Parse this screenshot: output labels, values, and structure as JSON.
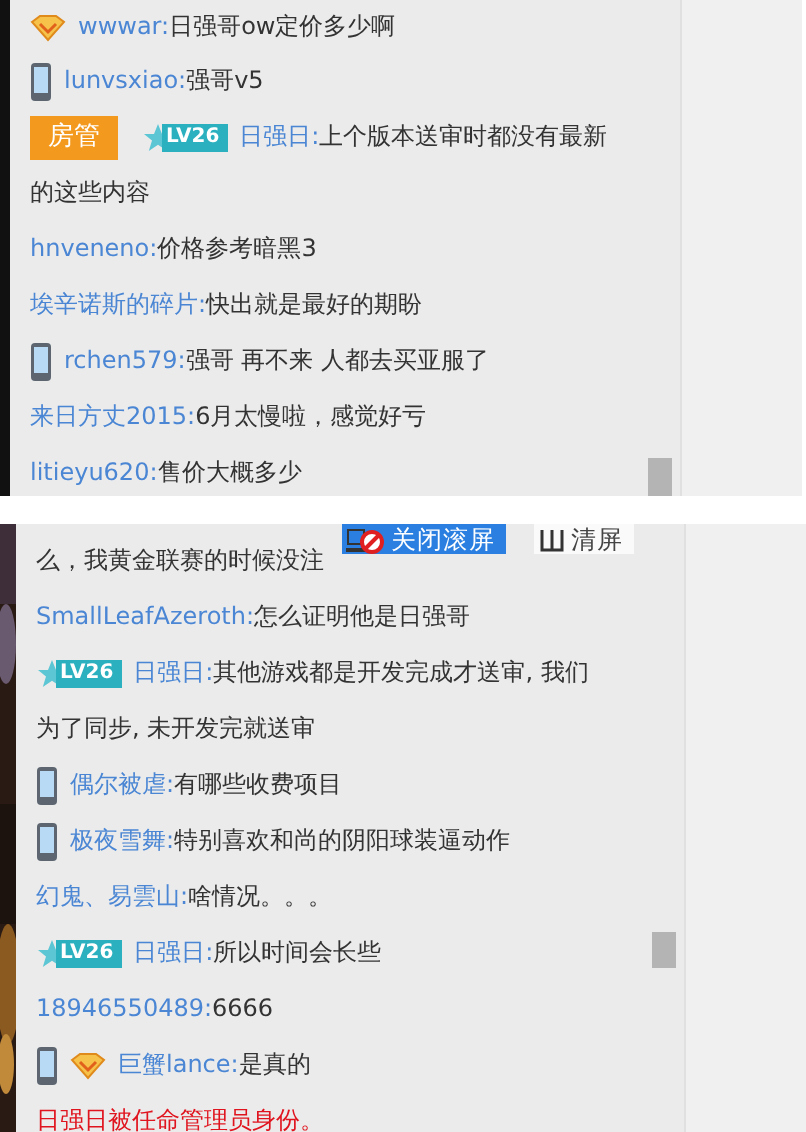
{
  "panels": [
    {
      "messages": [
        {
          "kind": "chat",
          "badges": [
            {
              "kind": "vip"
            }
          ],
          "user": "wwwar:",
          "text": "日强哥ow定价多少啊"
        },
        {
          "kind": "chat",
          "badges": [
            {
              "kind": "phone"
            }
          ],
          "user": "lunvsxiao:",
          "text": "强哥v5"
        },
        {
          "kind": "chat",
          "badges": [
            {
              "kind": "admin",
              "label": "房管"
            },
            {
              "kind": "level",
              "label": "LV26"
            }
          ],
          "user": "日强日:",
          "text": "上个版本送审时都没有最新",
          "text_continued": "的这些内容"
        },
        {
          "kind": "chat",
          "user": "hnveneno:",
          "text": "价格参考暗黑3"
        },
        {
          "kind": "chat",
          "user": "埃辛诺斯的碎片:",
          "text": "快出就是最好的期盼"
        },
        {
          "kind": "chat",
          "badges": [
            {
              "kind": "phone"
            }
          ],
          "user": "rchen579:",
          "text": "强哥 再不来 人都去买亚服了"
        },
        {
          "kind": "chat",
          "user": "来日方丈2015:",
          "text": "6月太慢啦，感觉好亏"
        },
        {
          "kind": "chat",
          "user": "litieyu620:",
          "text": "售价大概多少"
        }
      ]
    },
    {
      "toolbar": {
        "buttons": [
          {
            "kind": "scroll-lock",
            "label": "关闭滚屏",
            "selected": true
          },
          {
            "kind": "clear",
            "label": "清屏",
            "selected": false
          }
        ]
      },
      "messages": [
        {
          "kind": "fragment",
          "text": "么，我黄金联赛的时候没注"
        },
        {
          "kind": "chat",
          "user": "SmallLeafAzeroth:",
          "text": "怎么证明他是日强哥"
        },
        {
          "kind": "chat",
          "badges": [
            {
              "kind": "level",
              "label": "LV26"
            }
          ],
          "user": "日强日:",
          "text": "其他游戏都是开发完成才送审, 我们",
          "text_continued": "为了同步, 未开发完就送审"
        },
        {
          "kind": "chat",
          "badges": [
            {
              "kind": "phone"
            }
          ],
          "user": "偶尔被虐:",
          "text": "有哪些收费项目"
        },
        {
          "kind": "chat",
          "badges": [
            {
              "kind": "phone"
            }
          ],
          "user": "极夜雪舞:",
          "text": "特别喜欢和尚的阴阳球装逼动作"
        },
        {
          "kind": "chat",
          "user": "幻鬼、易雲山:",
          "text": "啥情况。。。"
        },
        {
          "kind": "chat",
          "badges": [
            {
              "kind": "level",
              "label": "LV26"
            }
          ],
          "user": "日强日:",
          "text": "所以时间会长些"
        },
        {
          "kind": "chat",
          "user": "18946550489:",
          "text": "6666"
        },
        {
          "kind": "chat",
          "badges": [
            {
              "kind": "phone"
            },
            {
              "kind": "vip"
            }
          ],
          "user": "巨蟹lance:",
          "text": "是真的"
        },
        {
          "kind": "system",
          "text": "日强日被任命管理员身份。"
        }
      ]
    }
  ]
}
